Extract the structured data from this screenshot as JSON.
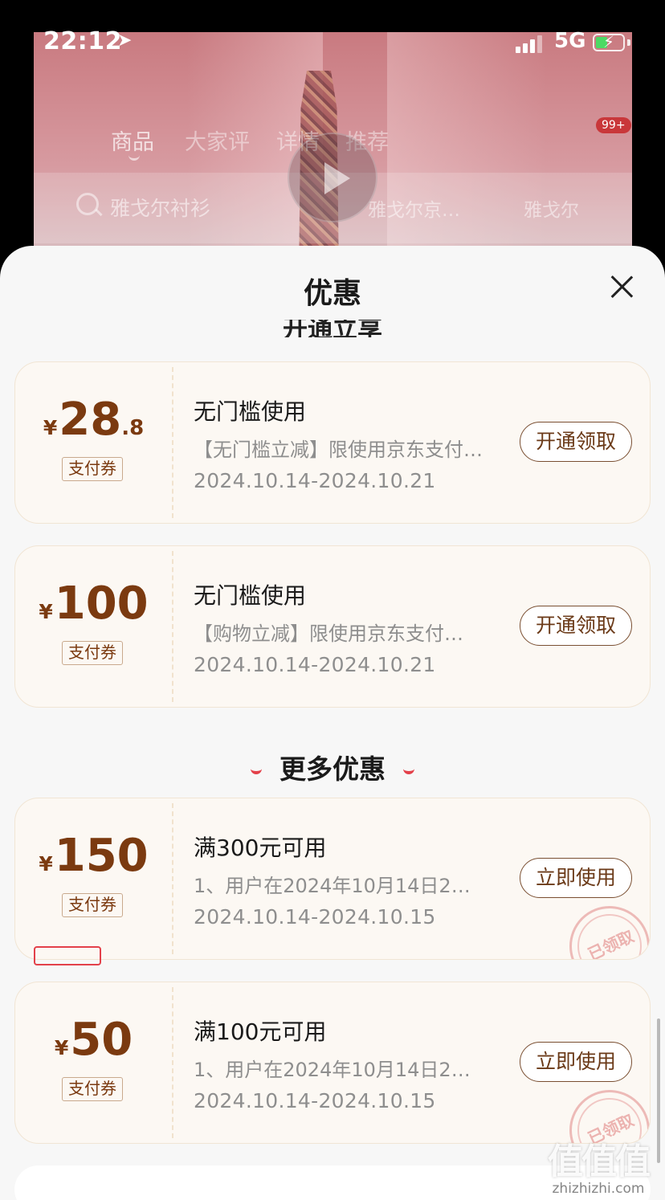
{
  "status_bar": {
    "time": "22:12",
    "network": "5G"
  },
  "product_page": {
    "tabs": [
      "商品",
      "大家评",
      "详情",
      "推荐"
    ],
    "cart_badge": "99+",
    "search_text": "雅戈尔衬衫",
    "suggestions": [
      "雅戈尔京…",
      "雅戈尔"
    ]
  },
  "sheet": {
    "title": "优惠",
    "partial_heading": "开通立享",
    "more_heading": "更多优惠",
    "coupons": [
      {
        "currency": "¥",
        "amount_int": "28",
        "amount_dec": ".8",
        "tag": "支付券",
        "title": "无门槛使用",
        "desc": "【无门槛立减】限使用京东支付…",
        "date": "2024.10.14-2024.10.21",
        "button": "开通领取",
        "claimed": false
      },
      {
        "currency": "¥",
        "amount_int": "100",
        "amount_dec": "",
        "tag": "支付券",
        "title": "无门槛使用",
        "desc": "【购物立减】限使用京东支付…",
        "date": "2024.10.14-2024.10.21",
        "button": "开通领取",
        "claimed": false
      },
      {
        "currency": "¥",
        "amount_int": "150",
        "amount_dec": "",
        "tag": "支付券",
        "title": "满300元可用",
        "desc": "1、用户在2024年10月14日2…",
        "date": "2024.10.14-2024.10.15",
        "button": "立即使用",
        "claimed": true,
        "stamp": "已领取"
      },
      {
        "currency": "¥",
        "amount_int": "50",
        "amount_dec": "",
        "tag": "支付券",
        "title": "满100元可用",
        "desc": "1、用户在2024年10月14日2…",
        "date": "2024.10.14-2024.10.15",
        "button": "立即使用",
        "claimed": true,
        "stamp": "已领取"
      }
    ]
  },
  "watermark": {
    "logo": "值值值",
    "url": "zhizhizhi.com"
  },
  "colors": {
    "accent_brown": "#7b3a10",
    "red": "#e3414a",
    "coupon_bg": "#fcf8f3"
  }
}
